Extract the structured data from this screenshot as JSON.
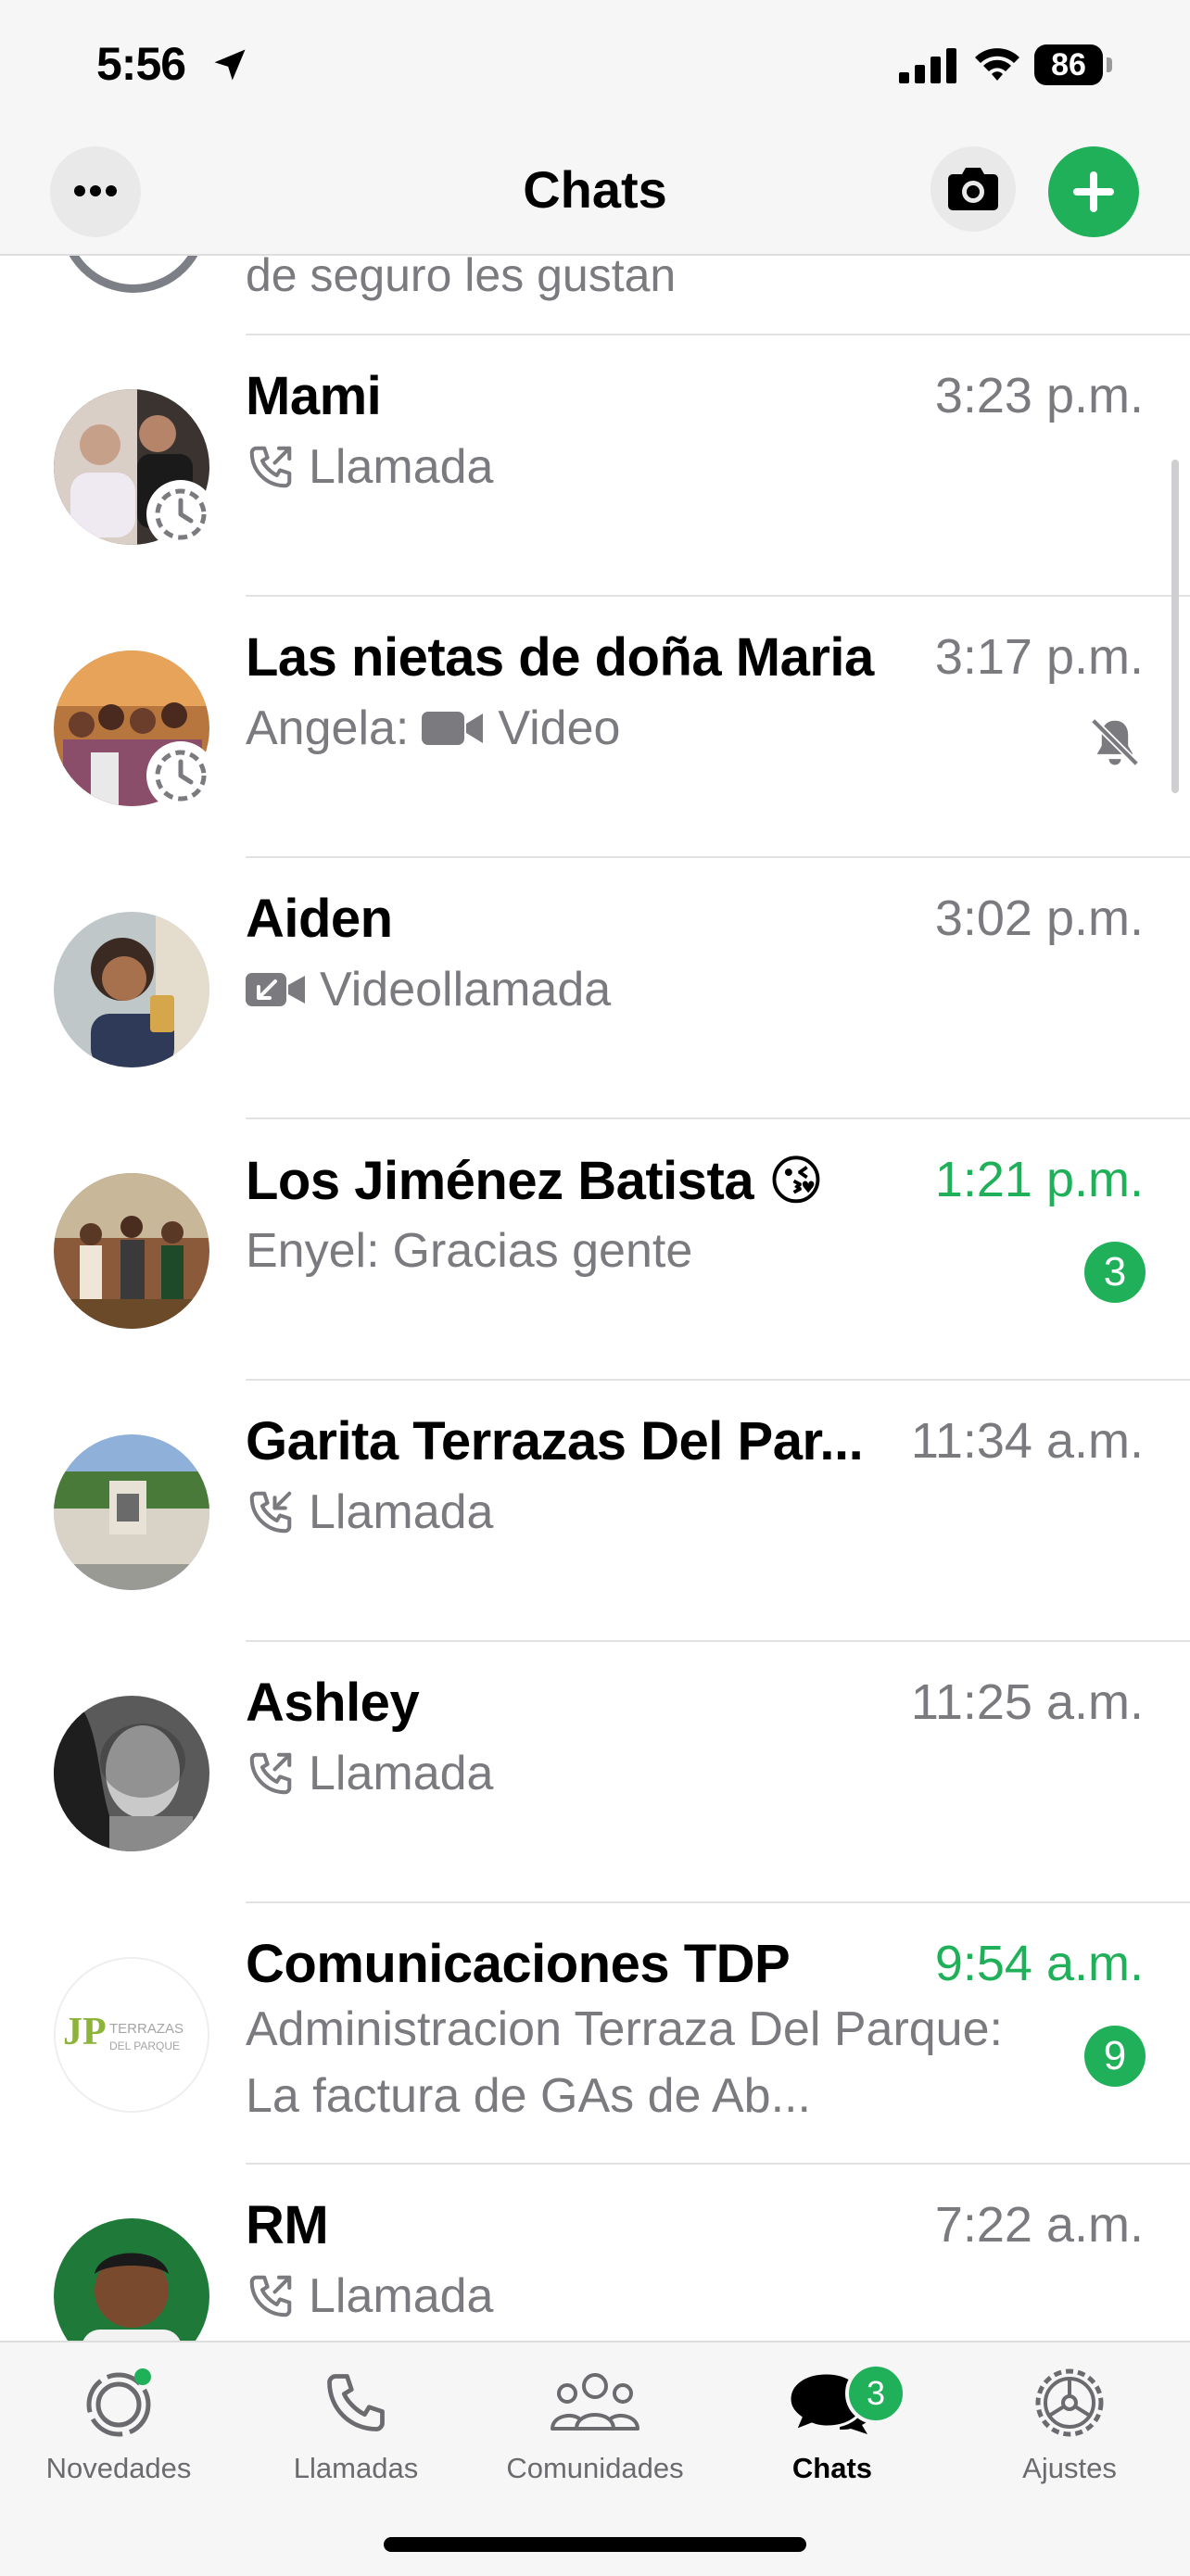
{
  "status_bar": {
    "time": "5:56",
    "battery": "86"
  },
  "header": {
    "title": "Chats"
  },
  "colors": {
    "accent": "#21b05a",
    "secondary_text": "#7a7a7f"
  },
  "previous_row_preview": "de seguro les gustan",
  "chats": [
    {
      "name": "Mami",
      "time_num": "3:23",
      "time_suffix": "p.m.",
      "icon": "outgoing-call-icon",
      "preview": "Llamada"
    },
    {
      "name": "Las nietas de doña Maria",
      "time_num": "3:17",
      "time_suffix": "p.m.",
      "sender": "Angela:",
      "icon": "video-icon",
      "preview": "Video",
      "muted": true
    },
    {
      "name": "Aiden",
      "time_num": "3:02",
      "time_suffix": "p.m.",
      "icon": "incoming-video-call-icon",
      "preview": "Videollamada"
    },
    {
      "name": "Los Jiménez Batista 😘",
      "time_num": "1:21",
      "time_suffix": "p.m.",
      "sender": "Enyel:",
      "preview": "Gracias gente",
      "unread": "3"
    },
    {
      "name": "Garita Terrazas Del Par...",
      "time_num": "11:34",
      "time_suffix": "a.m.",
      "icon": "incoming-call-icon",
      "preview": "Llamada"
    },
    {
      "name": "Ashley",
      "time_num": "11:25",
      "time_suffix": "a.m.",
      "icon": "outgoing-call-icon",
      "preview": "Llamada"
    },
    {
      "name": "Comunicaciones TDP",
      "time_num": "9:54",
      "time_suffix": "a.m.",
      "preview": "Administracion Terraza Del Parque: La factura de GAs de Ab...",
      "unread": "9"
    },
    {
      "name": "RM",
      "time_num": "7:22",
      "time_suffix": "a.m.",
      "icon": "outgoing-call-icon",
      "preview": "Llamada"
    }
  ],
  "logo_text": {
    "line1": "TERRAZAS",
    "line2": "DEL PARQUE"
  },
  "tab_bar": {
    "tabs": [
      {
        "label": "Novedades",
        "icon": "updates-icon"
      },
      {
        "label": "Llamadas",
        "icon": "phone-icon"
      },
      {
        "label": "Comunidades",
        "icon": "communities-icon"
      },
      {
        "label": "Chats",
        "icon": "chats-icon",
        "badge": "3",
        "active": true
      },
      {
        "label": "Ajustes",
        "icon": "settings-icon"
      }
    ]
  }
}
